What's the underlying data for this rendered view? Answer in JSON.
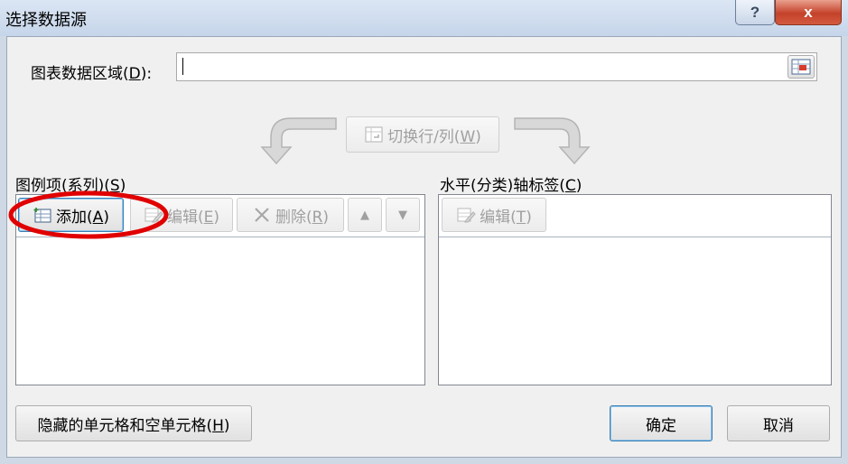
{
  "window": {
    "title": "选择数据源",
    "help": "?",
    "close": "x"
  },
  "range": {
    "label": "图表数据区域(",
    "key": "D",
    "label_end": "):",
    "value": ""
  },
  "switch_button": {
    "label": "切换行/列(",
    "key": "W",
    "label_end": ")"
  },
  "legend": {
    "header": "图例项(系列)(",
    "key": "S",
    "header_end": ")",
    "add": {
      "label": "添加(",
      "key": "A",
      "end": ")"
    },
    "edit": {
      "label": "编辑(",
      "key": "E",
      "end": ")"
    },
    "remove": {
      "label": "删除(",
      "key": "R",
      "end": ")"
    },
    "up": "▲",
    "down": "▼"
  },
  "axis": {
    "header": "水平(分类)轴标签(",
    "key": "C",
    "header_end": ")",
    "edit": {
      "label": "编辑(",
      "key": "T",
      "end": ")"
    }
  },
  "hidden_cells": {
    "label": "隐藏的单元格和空单元格(",
    "key": "H",
    "end": ")"
  },
  "ok": "确定",
  "cancel": "取消",
  "colors": {
    "annotation": "#e00000",
    "accent": "#3c7fb1"
  }
}
